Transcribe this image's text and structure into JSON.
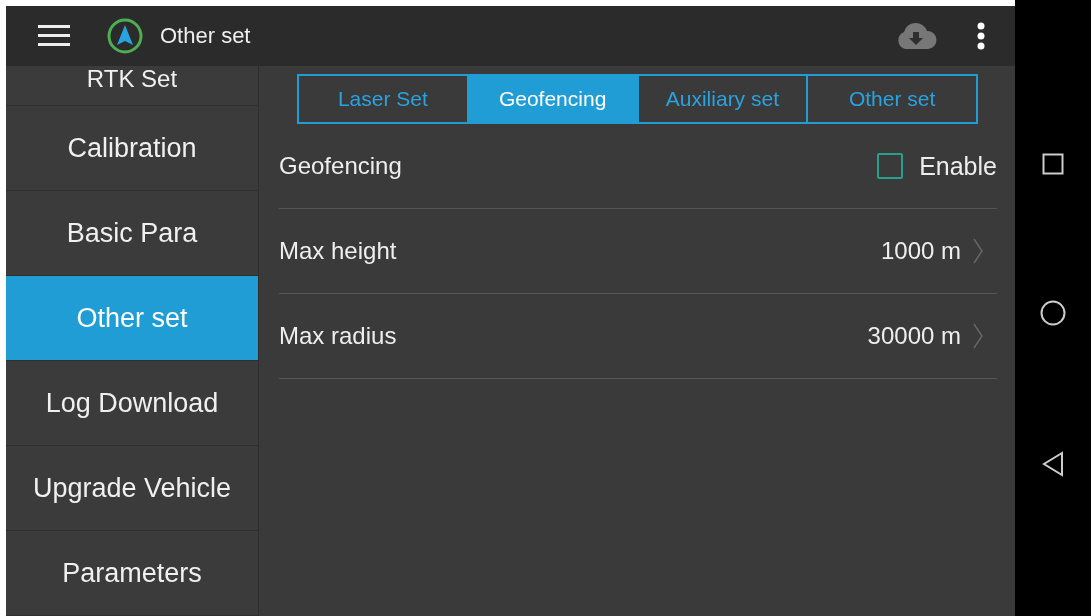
{
  "app_bar": {
    "title": "Other set"
  },
  "sidebar": {
    "items": [
      {
        "label": "RTK Set",
        "selected": false
      },
      {
        "label": "Calibration",
        "selected": false
      },
      {
        "label": "Basic Para",
        "selected": false
      },
      {
        "label": "Other set",
        "selected": true
      },
      {
        "label": "Log Download",
        "selected": false
      },
      {
        "label": "Upgrade Vehicle",
        "selected": false
      },
      {
        "label": "Parameters",
        "selected": false
      }
    ]
  },
  "tabs": [
    {
      "label": "Laser Set",
      "selected": false
    },
    {
      "label": "Geofencing",
      "selected": true
    },
    {
      "label": "Auxiliary set",
      "selected": false
    },
    {
      "label": "Other set",
      "selected": false
    }
  ],
  "settings": [
    {
      "kind": "checkbox",
      "label": "Geofencing",
      "option": "Enable",
      "checked": false
    },
    {
      "kind": "value",
      "label": "Max height",
      "value": "1000 m"
    },
    {
      "kind": "value",
      "label": "Max radius",
      "value": "30000 m"
    }
  ]
}
